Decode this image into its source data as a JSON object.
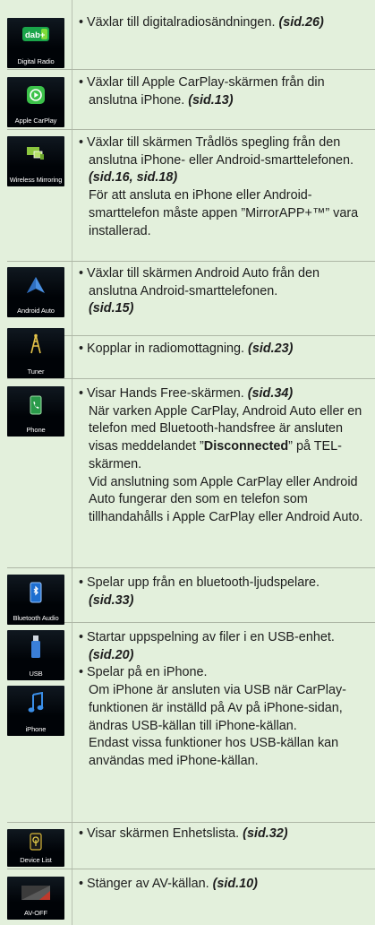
{
  "items": [
    {
      "icon_name": "dab-radio-icon",
      "icon_label": "Digital Radio",
      "dab_logo": "dab+",
      "desc": "Växlar till digitalradiosändningen.",
      "ref": "(sid.26)"
    },
    {
      "icon_name": "apple-carplay-icon",
      "icon_label": "Apple CarPlay",
      "desc": "Växlar till Apple CarPlay-skärmen från din anslutna iPhone.",
      "ref": "(sid.13)"
    },
    {
      "icon_name": "wireless-mirroring-icon",
      "icon_label": "Wireless Mirroring",
      "desc": "Växlar till skärmen Trådlös spegling från den anslutna iPhone- eller Android-smarttelefonen.",
      "ref": "(sid.16, sid.18)",
      "note": "För att ansluta en iPhone eller Android-smarttelefon måste appen ”MirrorAPP+™” vara installerad."
    },
    {
      "icon_name": "android-auto-icon",
      "icon_label": "Android Auto",
      "desc": "Växlar till skärmen Android Auto från den anslutna Android-smarttelefonen.",
      "ref": "(sid.15)"
    },
    {
      "icon_name": "tuner-icon",
      "icon_label": "Tuner",
      "desc": "Kopplar in radiomottagning.",
      "ref": "(sid.23)"
    },
    {
      "icon_name": "phone-icon",
      "icon_label": "Phone",
      "desc": "Visar Hands Free-skärmen.",
      "ref": "(sid.34)",
      "note_pre": "När varken Apple CarPlay, Android Auto eller en telefon med Bluetooth-handsfree är ansluten visas meddelandet ”",
      "note_bold": "Disconnected",
      "note_post": "” på TEL-skärmen.",
      "note2": "Vid anslutning som Apple CarPlay eller Android Auto fungerar den som en telefon som tillhandahålls i Apple CarPlay eller Android Auto."
    },
    {
      "icon_name": "bluetooth-audio-icon",
      "icon_label": "Bluetooth Audio",
      "desc": "Spelar upp från en bluetooth-ljudspelare.",
      "ref": "(sid.33)"
    },
    {
      "icon_name": "usb-icon",
      "icon_label": "USB",
      "icon2_name": "iphone-music-icon",
      "icon2_label": "iPhone",
      "desc": "Startar uppspelning av filer i en USB-enhet.",
      "ref": "(sid.20)",
      "desc2": "Spelar på en iPhone.",
      "note": "Om iPhone är ansluten via USB när CarPlay-funktionen är inställd på Av på iPhone-sidan, ändras USB-källan till iPhone-källan.",
      "note2": "Endast vissa funktioner hos USB-källan kan användas med iPhone-källan."
    },
    {
      "icon_name": "device-list-icon",
      "icon_label": "Device List",
      "desc": "Visar skärmen Enhetslista.",
      "ref": "(sid.32)"
    },
    {
      "icon_name": "av-off-icon",
      "icon_label": "AV-OFF",
      "desc": "Stänger av AV-källan.",
      "ref": "(sid.10)"
    }
  ],
  "bullet": "•",
  "colors": {
    "background": "#e3f0dc",
    "separator": "#aeb7a6",
    "icon_bg": "#000307",
    "text": "#1e1e1e"
  }
}
